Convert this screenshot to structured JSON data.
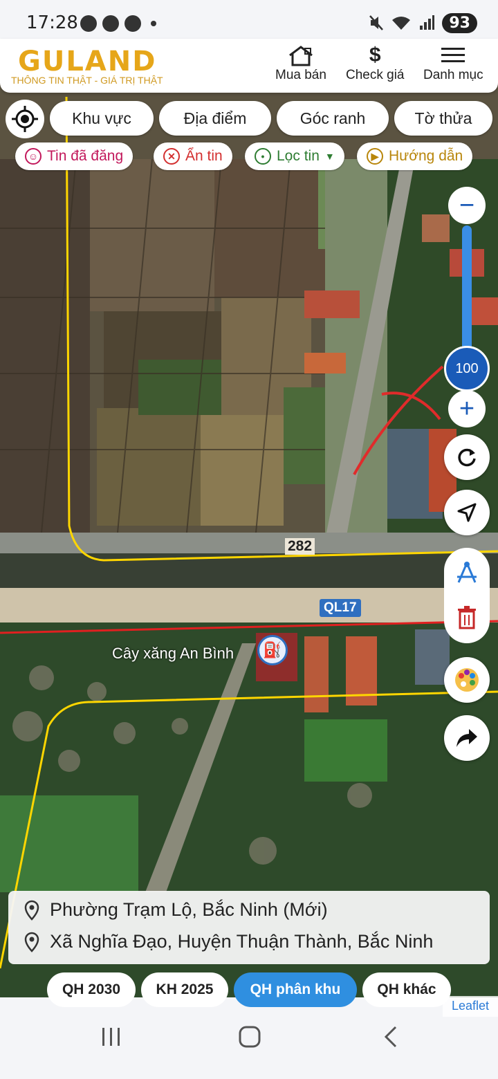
{
  "status_bar": {
    "time": "17:28",
    "battery": "93"
  },
  "header": {
    "logo": "GULAND",
    "tagline": "THÔNG TIN THẬT - GIÁ TRỊ THẬT",
    "nav": [
      {
        "label": "Mua bán",
        "icon": "house-icon"
      },
      {
        "label": "Check giá",
        "icon": "dollar-icon"
      },
      {
        "label": "Danh mục",
        "icon": "menu-icon"
      }
    ]
  },
  "filters": [
    "Khu vực",
    "Địa điểm",
    "Góc ranh",
    "Tờ thửa"
  ],
  "chips": [
    {
      "label": "Tin đã đăng",
      "color": "#c2185b"
    },
    {
      "label": "Ẩn tin",
      "color": "#d32f2f"
    },
    {
      "label": "Lọc tin",
      "color": "#2e7d32"
    },
    {
      "label": "Hướng dẫn",
      "color": "#b8860b"
    }
  ],
  "zoom": {
    "value": "100"
  },
  "map_labels": {
    "road_282": "282",
    "road_ql17": "QL17",
    "poi": "Cây xăng An Bình"
  },
  "address": {
    "line1": "Phường Trạm Lộ, Bắc Ninh (Mới)",
    "line2": "Xã Nghĩa Đạo, Huyện Thuận Thành, Bắc Ninh"
  },
  "plans": [
    "QH 2030",
    "KH 2025",
    "QH phân khu",
    "QH khác"
  ],
  "active_plan": "QH phân khu",
  "attribution": "Leaflet"
}
